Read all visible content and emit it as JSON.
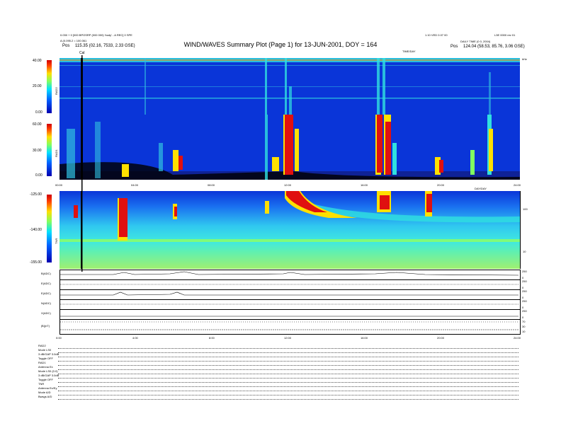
{
  "header": {
    "left_line1": "0.030 + 0 [000 BPOSRP (000 000) 'body' - A REC] 0 SPE",
    "left_line2": "A (0.095.2 = 100.061",
    "left_pos_label": "Pos",
    "left_pos_value": "115.35 (02.16, 7533, 2.33 GSE)",
    "right_line1": "1.10 VED 0.07 00",
    "right_line1b": "L3E 0000 rev 01",
    "right_line2": "DAILY TIME (0 0, 2004)",
    "right_line2b": "TIME/DAY",
    "right_pos_label": "Pos",
    "right_pos_value": "124.04 (58.53, 85.76, 3.06 GSE)",
    "cal_label": "Cal",
    "khz_label": "kHz"
  },
  "title": "WIND/WAVES Summary Plot (Page 1) for 13-JUN-2001, DOY = 164",
  "colors": {
    "bg_blue": "#0a35d8",
    "red": "#e01010",
    "cyan": "#30e0e0",
    "black": "#000000"
  },
  "chart_data": [
    {
      "type": "heatmap",
      "name_label": "RAD2",
      "colorbar_ticks": [
        "40.00",
        "20.00",
        "0.00"
      ],
      "colorbar_range": [
        0,
        40
      ]
    },
    {
      "type": "heatmap",
      "name_label": "RAD1",
      "colorbar_ticks": [
        "60.00",
        "30.00",
        "0.00"
      ],
      "colorbar_range": [
        0,
        60
      ],
      "x_ticks": [
        "00:00",
        "04:00",
        "08:00",
        "12:00",
        "16:00",
        "20:00",
        "24:00"
      ],
      "x_range": [
        0,
        24
      ],
      "x_note": "DAY/DAY"
    },
    {
      "type": "heatmap",
      "name_label": "TNR",
      "colorbar_ticks": [
        "-125.00",
        "-140.00",
        "-155.00"
      ],
      "colorbar_range": [
        -155,
        -125
      ],
      "right_ticks": [
        "100",
        "10"
      ]
    },
    {
      "type": "line",
      "traces": [
        {
          "label": "B(ADC)",
          "right_ticks": [
            "250",
            "0"
          ]
        },
        {
          "label": "E(ADC)",
          "right_ticks": [
            "250",
            "0"
          ]
        },
        {
          "label": "E(ADC)",
          "right_ticks": [
            "250",
            "0"
          ]
        },
        {
          "label": "N(ADC)",
          "right_ticks": [
            "250",
            "0"
          ]
        },
        {
          "label": "X(ADC)",
          "right_ticks": [
            "250",
            "0"
          ]
        },
        {
          "label": "|B|(nT)",
          "right_ticks": [
            "70",
            "30",
            "10"
          ]
        }
      ],
      "x_ticks": [
        "0:00",
        "4:00",
        "8:00",
        "12:00",
        "16:00",
        "20:00",
        "24:00"
      ],
      "x_range": [
        0,
        24
      ]
    }
  ],
  "info_block": [
    "RAD2",
    "Mode     LS0",
    "3 dB/GAP 3.0dB",
    "Toggle   OFF",
    "RAD1",
    "Antenna  Ex",
    "Mode     LS0 (0.0)",
    "3 dB/GAP 3.0dB",
    "Toggle   OFF",
    "TNR",
    "Antenna  Ex/Ey",
    "Mode     A/D",
    "Bwsgs    A/D"
  ]
}
